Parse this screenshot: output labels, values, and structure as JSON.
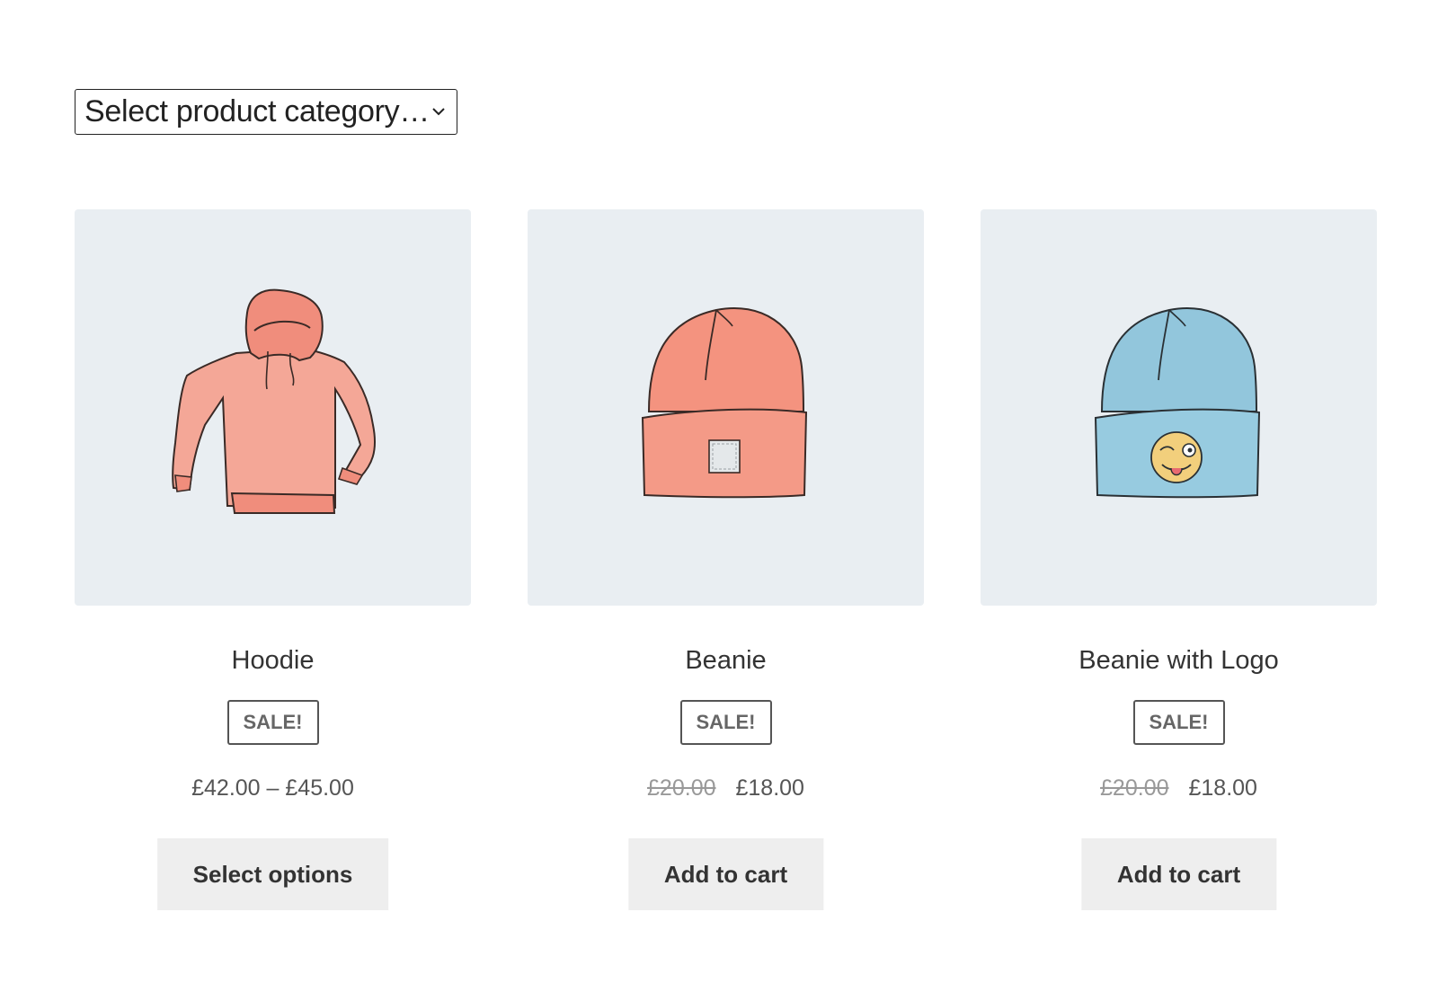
{
  "category_select": {
    "selected": "Select product category…",
    "icon": "chevron-down-icon"
  },
  "colors": {
    "thumb_bg": "#e9eef2",
    "hoodie": "#f4a797",
    "beanie": "#f4937f",
    "beanie_logo": "#92c6dc",
    "button_bg": "#eeeeee"
  },
  "products": [
    {
      "title": "Hoodie",
      "badge": "SALE!",
      "price_range": "£42.00 – £45.00",
      "button": "Select options",
      "image": "hoodie-illustration"
    },
    {
      "title": "Beanie",
      "badge": "SALE!",
      "old_price": "£20.00",
      "price": "£18.00",
      "button": "Add to cart",
      "image": "beanie-illustration"
    },
    {
      "title": "Beanie with Logo",
      "badge": "SALE!",
      "old_price": "£20.00",
      "price": "£18.00",
      "button": "Add to cart",
      "image": "beanie-with-logo-illustration"
    }
  ]
}
